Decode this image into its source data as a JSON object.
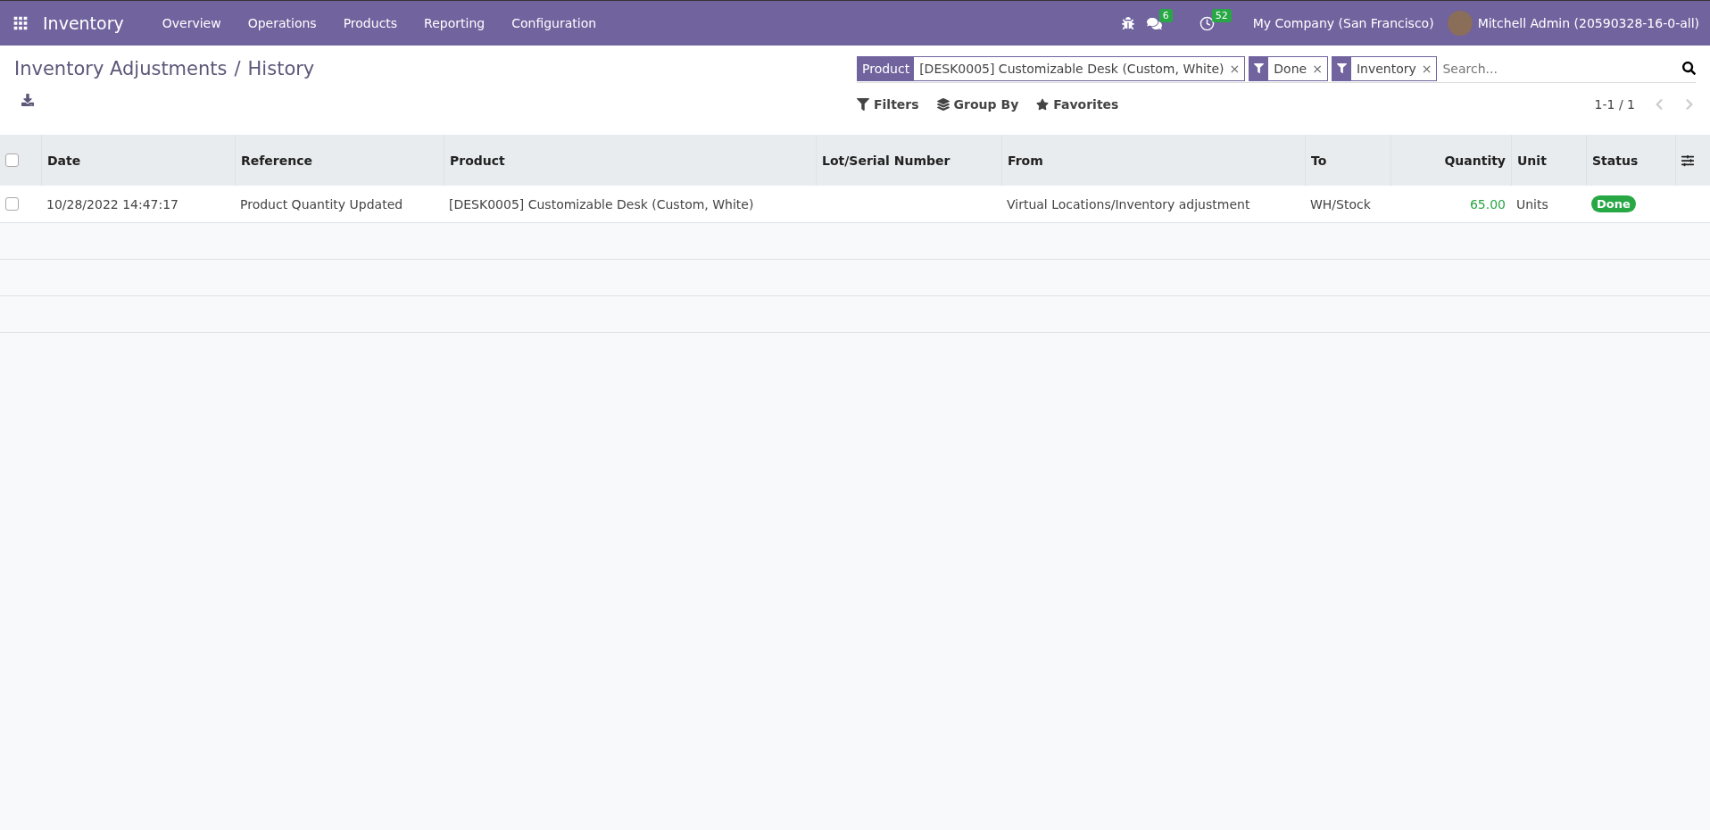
{
  "navbar": {
    "app": "Inventory",
    "menu": [
      "Overview",
      "Operations",
      "Products",
      "Reporting",
      "Configuration"
    ],
    "messages_count": "6",
    "activities_count": "52",
    "company": "My Company (San Francisco)",
    "user": "Mitchell Admin (20590328-16-0-all)"
  },
  "breadcrumb": {
    "items": [
      "Inventory Adjustments",
      "History"
    ],
    "separator": "/"
  },
  "search": {
    "facets": [
      {
        "kind": "field",
        "label": "Product",
        "value": "[DESK0005] Customizable Desk (Custom, White)",
        "remove": "×"
      },
      {
        "kind": "filter",
        "value": "Done",
        "remove": "×"
      },
      {
        "kind": "filter",
        "value": "Inventory",
        "remove": "×"
      }
    ],
    "placeholder": "Search..."
  },
  "controls": [
    "Filters",
    "Group By",
    "Favorites"
  ],
  "pager": "1-1 / 1",
  "table": {
    "select_all_checked": false,
    "columns": [
      {
        "label": "Date",
        "kind": "text"
      },
      {
        "label": "Reference",
        "kind": "text"
      },
      {
        "label": "Product",
        "kind": "text"
      },
      {
        "label": "Lot/Serial Number",
        "kind": "text"
      },
      {
        "label": "From",
        "kind": "text"
      },
      {
        "label": "To",
        "kind": "text"
      },
      {
        "label": "Quantity",
        "kind": "number"
      },
      {
        "label": "Unit",
        "kind": "text"
      },
      {
        "label": "Status",
        "kind": "status"
      }
    ],
    "rows": [
      {
        "checked": false,
        "cells": [
          "10/28/2022 14:47:17",
          "Product Quantity Updated",
          "[DESK0005] Customizable Desk (Custom, White)",
          "",
          "Virtual Locations/Inventory adjustment",
          "WH/Stock",
          "65.00",
          "Units",
          "Done"
        ]
      }
    ]
  }
}
